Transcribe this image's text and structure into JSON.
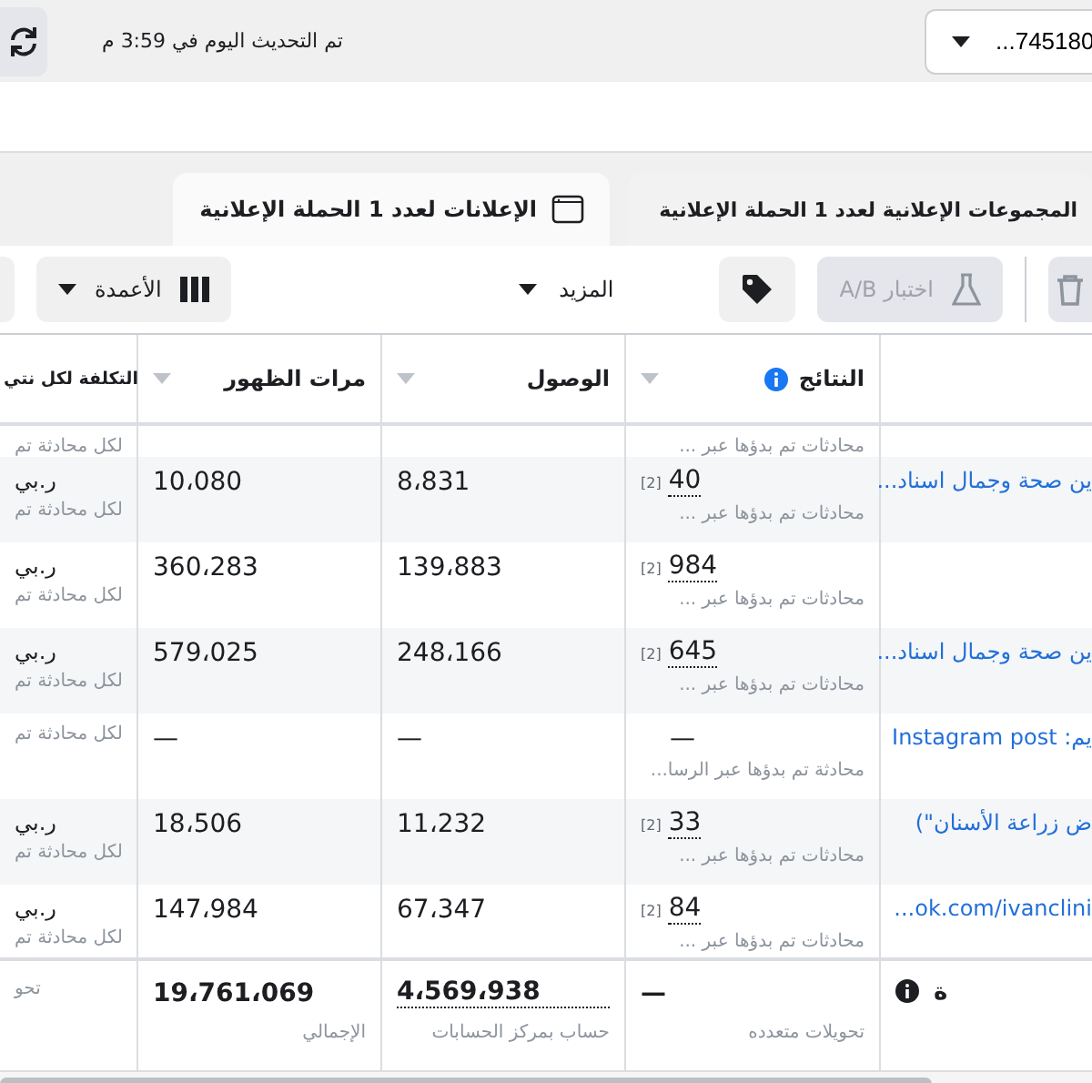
{
  "top_bar": {
    "account_dropdown": "...745180",
    "updated": "تم التحديث اليوم في 3:59 م"
  },
  "tabs": [
    {
      "label": "المجموعات الإعلانية لعدد **1** الحملة الإعلانية",
      "selected": false,
      "kind": "plain"
    },
    {
      "label": "الإعلانات لعدد **1** الحملة الإعلانية",
      "selected": true,
      "kind": "icon"
    }
  ],
  "toolbar": {
    "ab_test": {
      "label": "اختبار A/B",
      "disabled": true
    },
    "more": "المزيد",
    "columns": "الأعمدة"
  },
  "table": {
    "columns": [
      {
        "label": "النتائج",
        "info": true
      },
      {
        "label": "الوصول",
        "info": false
      },
      {
        "label": "مرات الظهور",
        "info": false
      },
      {
        "label": "التكلفة لكل نتي",
        "info": false
      }
    ],
    "rows": [
      {
        "kind": "partial",
        "results_sub": "محادثات تم بدؤها عبر ...",
        "cost_sub": "لكل محادثة تم"
      },
      {
        "kind": "full",
        "name": "ين صحة وجمال اسناد...",
        "results": "40",
        "note": "[2]",
        "results_sub": "محادثات تم بدؤها عبر ...",
        "reach": "8،831",
        "impressions": "10،080",
        "cost": "ر.بي",
        "cost_sub": "لكل محادثة تم"
      },
      {
        "kind": "full",
        "results": "984",
        "note": "[2]",
        "results_sub": "محادثات تم بدؤها عبر ...",
        "reach": "139،883",
        "impressions": "360،283",
        "cost": "ر.بي",
        "cost_sub": "لكل محادثة تم"
      },
      {
        "kind": "full",
        "name": "ين صحة وجمال اسناد...",
        "results": "645",
        "note": "[2]",
        "results_sub": "محادثات تم بدؤها عبر ...",
        "reach": "248،166",
        "impressions": "579،025",
        "cost": "ر.بي",
        "cost_sub": "لكل محادثة تم"
      },
      {
        "kind": "full",
        "name": "يم: Instagram post",
        "results": "—",
        "results_sub": "محادثة تم بدؤها عبر الرسا...",
        "reach": "—",
        "impressions": "—",
        "cost_sub": "لكل محادثة تم"
      },
      {
        "kind": "full",
        "name": "ض زراعة الأسنان\")",
        "results": "33",
        "note": "[2]",
        "results_sub": "محادثات تم بدؤها عبر ...",
        "reach": "11،232",
        "impressions": "18،506",
        "cost": "ر.بي",
        "cost_sub": "لكل محادثة تم"
      },
      {
        "kind": "full",
        "name": "...ok.com/ivanclini",
        "results": "84",
        "note": "[2]",
        "results_sub": "محادثات تم بدؤها عبر ...",
        "reach": "67،347",
        "impressions": "147،984",
        "cost": "ر.بي",
        "cost_sub": "لكل محادثة تم"
      }
    ],
    "footer": {
      "name": "ة",
      "results": "—",
      "results_sub": "تحويلات متعدده",
      "reach": "4،569،938",
      "reach_sub": "حساب بمركز الحسابات",
      "impressions": "19،761،069",
      "impressions_sub": "الإجمالي",
      "cost_sub": "تحو"
    }
  }
}
